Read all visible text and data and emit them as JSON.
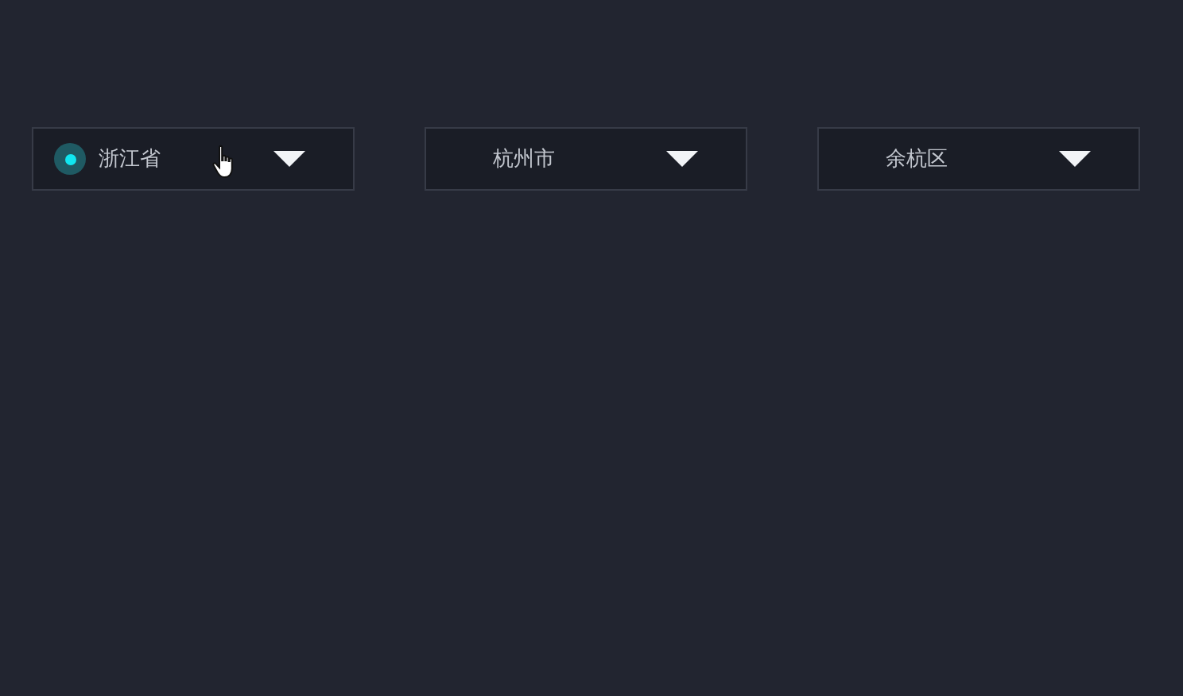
{
  "selects": [
    {
      "value": "浙江省",
      "active": true,
      "hovered": true
    },
    {
      "value": "杭州市",
      "active": false,
      "hovered": false
    },
    {
      "value": "余杭区",
      "active": false,
      "hovered": false
    }
  ]
}
